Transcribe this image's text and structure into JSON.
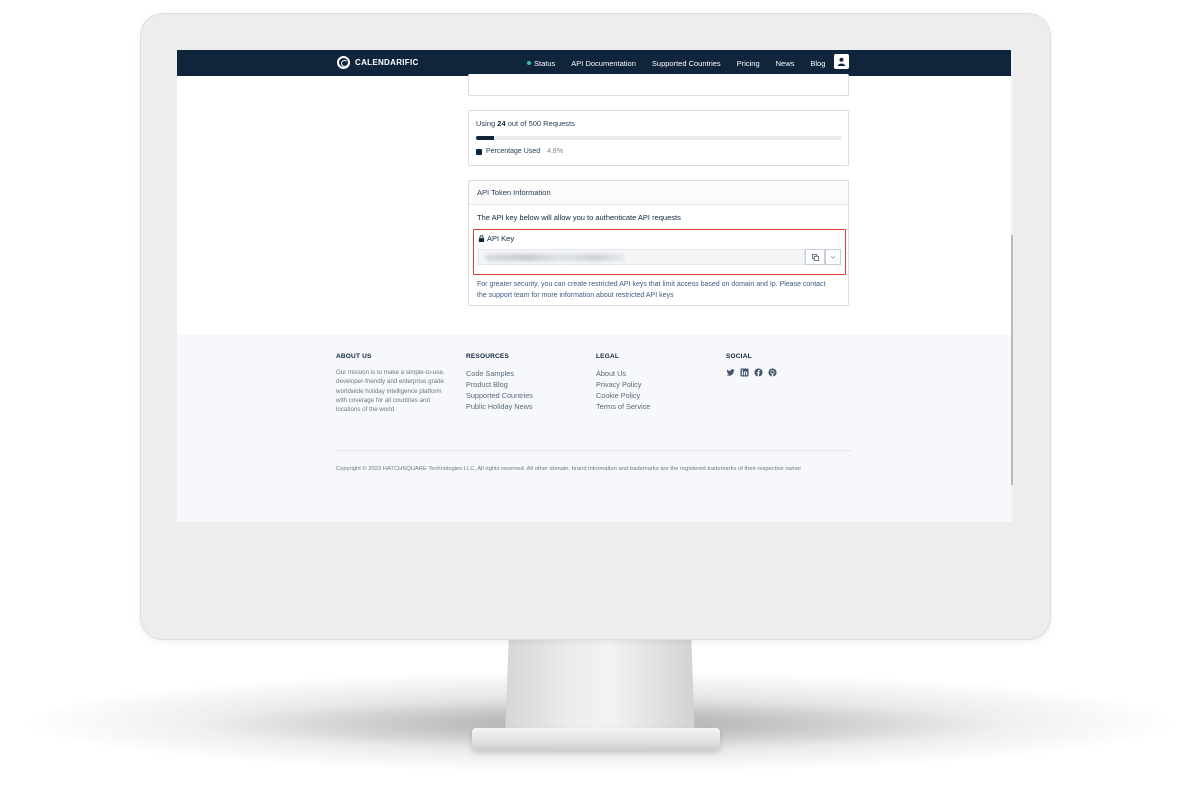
{
  "brand": {
    "name": "CALENDARIFIC"
  },
  "nav": {
    "items": [
      {
        "label": "Status"
      },
      {
        "label": "API Documentation"
      },
      {
        "label": "Supported Countries"
      },
      {
        "label": "Pricing"
      },
      {
        "label": "News"
      },
      {
        "label": "Blog"
      }
    ],
    "status_dot_color": "#2ec4b6",
    "user_icon": "user-icon"
  },
  "usage": {
    "prefix": "Using",
    "used": "24",
    "suffix": "out of 500 Requests",
    "percent_used_fraction": 0.048,
    "legend_label": "Percentage Used",
    "legend_value": "4.8%"
  },
  "token": {
    "title": "API Token Information",
    "description": "The API key below will allow you to authenticate API requests",
    "key_label": "API Key",
    "key_value_hidden": true,
    "copy_icon": "copy-icon",
    "dropdown_icon": "chevron-down-icon",
    "note": "For greater security, you can create restricted API keys that limit access based on domain and Ip. Please contact the support team for more information about restricted API keys"
  },
  "footer": {
    "about": {
      "heading": "ABOUT US",
      "text": "Our mission is to make a simple-to-use, developer-friendly and enterprise grade worldwide holiday intelligence platform with coverage for all countries and locations of the world."
    },
    "resources": {
      "heading": "RESOURCES",
      "links": [
        "Code Samples",
        "Product Blog",
        "Supported Countries",
        "Public Holiday News"
      ]
    },
    "legal": {
      "heading": "LEGAL",
      "links": [
        "About Us",
        "Privacy Policy",
        "Cookie Policy",
        "Terms of Service"
      ]
    },
    "social": {
      "heading": "SOCIAL",
      "icons": [
        "twitter-icon",
        "linkedin-icon",
        "facebook-icon",
        "github-icon"
      ]
    },
    "copyright": "Copyright © 2023 HATCHSQUARE Technologies LLC, All rights reserved. All other domain, brand information and trademarks are the registered trademarks of their respective owner"
  },
  "colors": {
    "navbar": "#10243b",
    "highlight_border": "#e33a3a",
    "footer_bg": "#f6f8fb"
  }
}
